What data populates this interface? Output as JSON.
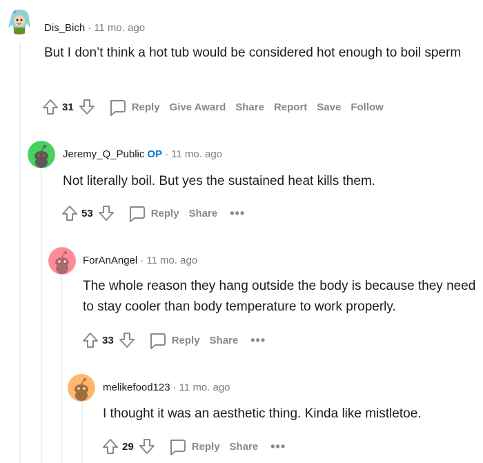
{
  "comments": [
    {
      "username": "Dis_Bich",
      "op": "",
      "time": "11 mo. ago",
      "body": "But I don’t think a hot tub would be considered hot enough to boil sperm",
      "votes": "31",
      "actions": [
        "Reply",
        "Give Award",
        "Share",
        "Report",
        "Save",
        "Follow"
      ],
      "avatar_color": "#8fd1d9"
    },
    {
      "username": "Jeremy_Q_Public",
      "op": "OP",
      "time": "11 mo. ago",
      "body": "Not literally boil. But yes the sustained heat kills them.",
      "votes": "53",
      "actions": [
        "Reply",
        "Share"
      ],
      "avatar_color": "#46d160"
    },
    {
      "username": "ForAnAngel",
      "op": "",
      "time": "11 mo. ago",
      "body": "The whole reason they hang outside the body is because they need to stay cooler than body temperature to work properly.",
      "votes": "33",
      "actions": [
        "Reply",
        "Share"
      ],
      "avatar_color": "#ff8b99"
    },
    {
      "username": "melikefood123",
      "op": "",
      "time": "11 mo. ago",
      "body": "I thought it was an aesthetic thing. Kinda like mistletoe.",
      "votes": "29",
      "actions": [
        "Reply",
        "Share"
      ],
      "avatar_color": "#ffb470"
    }
  ],
  "icons": {
    "upvote": "upvote-icon",
    "downvote": "downvote-icon",
    "reply": "chat-bubble-icon",
    "more": "more-options-icon"
  },
  "colors": {
    "op_badge": "#0079d3",
    "muted": "#878a8c",
    "thread_line": "#edeff1"
  }
}
